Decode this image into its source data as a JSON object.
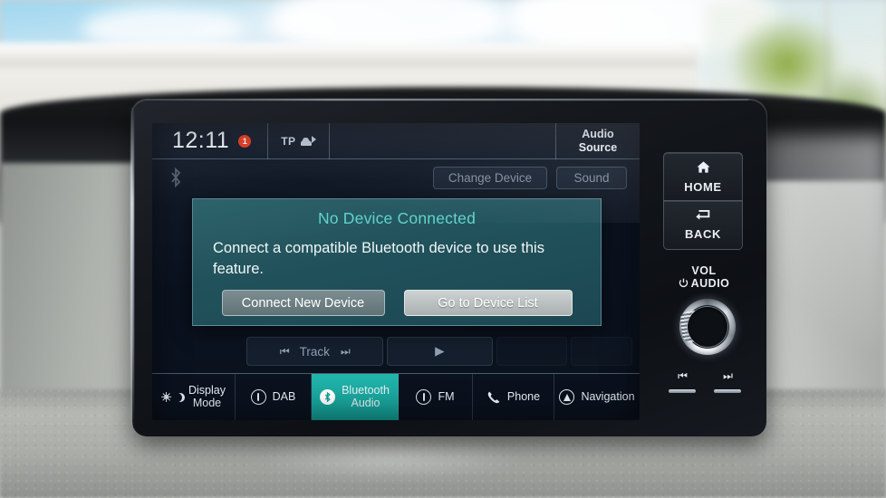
{
  "status_bar": {
    "clock": "12:11",
    "notification_count": "1",
    "tp_label": "TP",
    "tp_icon": "traffic-car-icon",
    "audio_source_line1": "Audio",
    "audio_source_line2": "Source"
  },
  "sub_bar": {
    "bluetooth_status_icon": "bluetooth-icon",
    "change_device_label": "Change Device",
    "sound_label": "Sound"
  },
  "dialog": {
    "title": "No Device Connected",
    "message": "Connect a compatible Bluetooth device to use this feature.",
    "primary_button": "Connect New Device",
    "secondary_button": "Go to Device List"
  },
  "transport": {
    "prev_glyph": "⏮",
    "track_label": "Track",
    "next_glyph": "⏭",
    "play_glyph": "▶"
  },
  "tabs": [
    {
      "label_line1": "Display",
      "label_line2": "Mode",
      "icon": "sun-moon-icon",
      "active": false
    },
    {
      "label_line1": "DAB",
      "label_line2": "",
      "icon": "radio-antenna-icon",
      "active": false
    },
    {
      "label_line1": "Bluetooth",
      "label_line2": "Audio",
      "icon": "bluetooth-icon",
      "active": true
    },
    {
      "label_line1": "FM",
      "label_line2": "",
      "icon": "radio-antenna-icon",
      "active": false
    },
    {
      "label_line1": "Phone",
      "label_line2": "",
      "icon": "phone-handset-icon",
      "active": false
    },
    {
      "label_line1": "Navigation",
      "label_line2": "",
      "icon": "compass-icon",
      "active": false
    }
  ],
  "hard_buttons": {
    "home_label": "HOME",
    "home_icon": "home-icon",
    "back_label": "BACK",
    "back_icon": "back-arrow-icon",
    "vol_line1": "VOL",
    "vol_line2": "AUDIO",
    "power_icon": "power-icon",
    "knob_name": "volume-knob",
    "prev_glyph": "⏮",
    "next_glyph": "⏭"
  },
  "colors": {
    "accent_teal": "#17a79e",
    "dialog_title": "#5fd4c8",
    "notification_red": "#e8341c",
    "dialog_bg": "#21525c"
  }
}
